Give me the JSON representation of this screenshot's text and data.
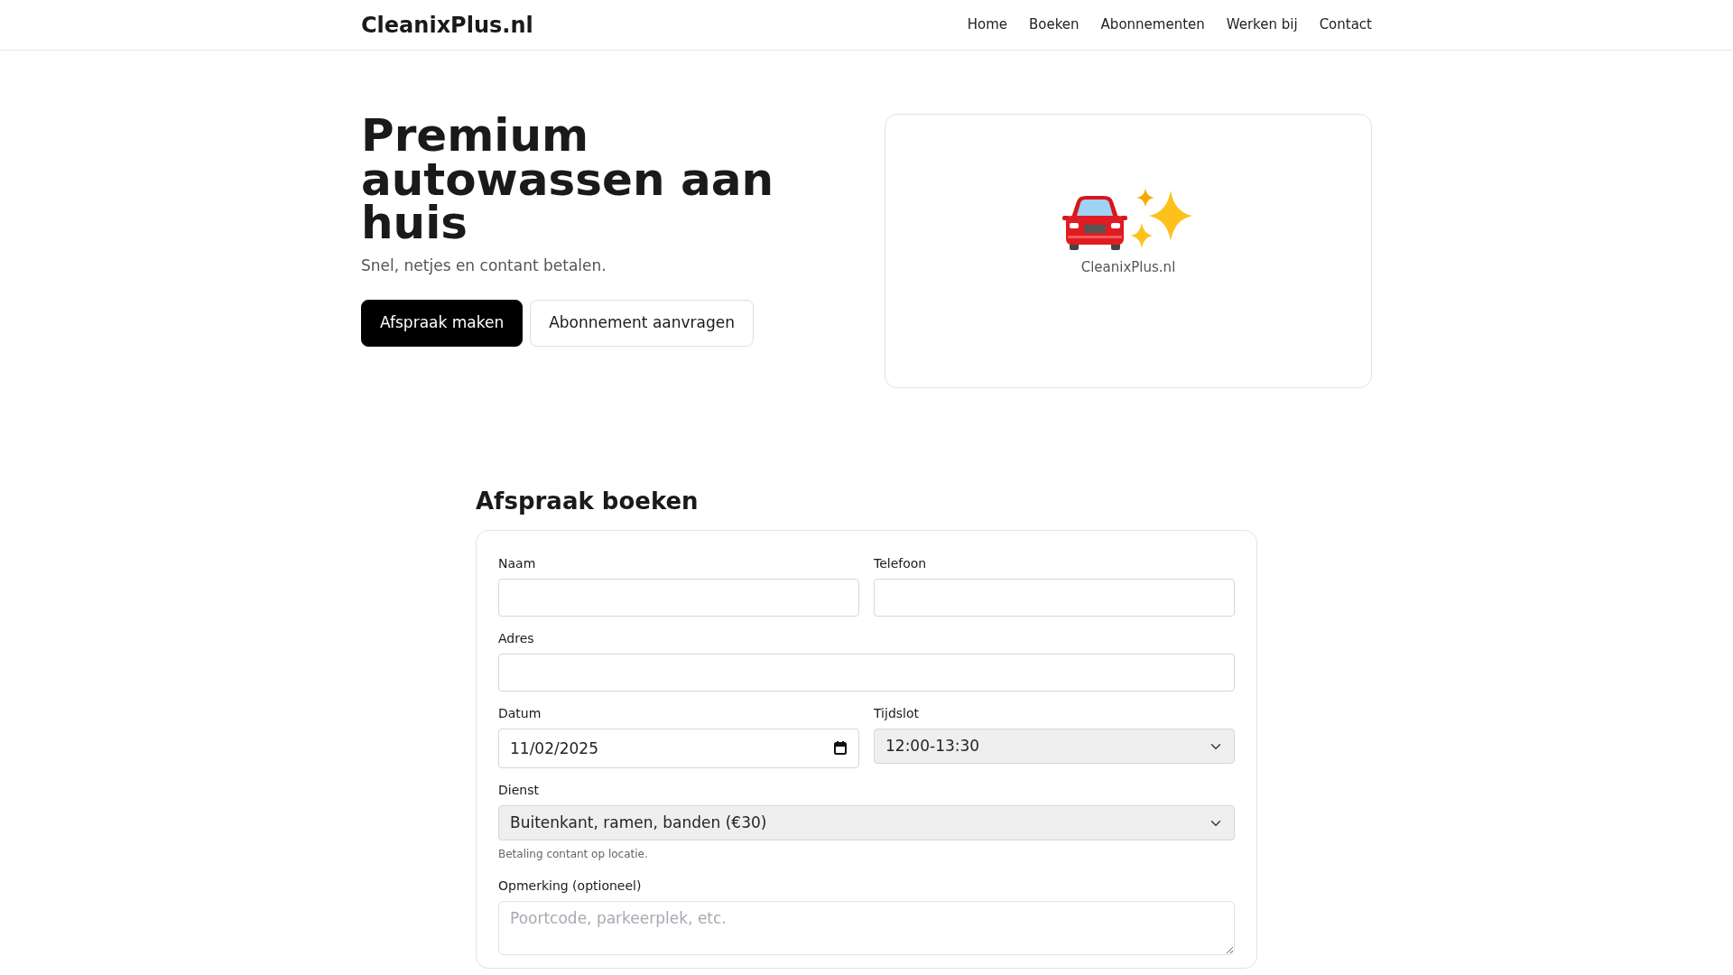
{
  "navbar": {
    "brand": "CleanixPlus.nl",
    "links": [
      "Home",
      "Boeken",
      "Abonnementen",
      "Werken bij",
      "Contact"
    ]
  },
  "hero": {
    "title": "Premium autowassen aan huis",
    "subtitle": "Snel, netjes en contant betalen.",
    "buttons": [
      {
        "label": "Afspraak maken",
        "kind": "primary"
      },
      {
        "label": "Abonnement aanvragen",
        "kind": "outline"
      }
    ],
    "card": {
      "caption": "CleanixPlus.nl"
    }
  },
  "booking": {
    "title": "Afspraak boeken",
    "rows": [
      [
        {
          "kind": "text",
          "label": "Naam"
        },
        {
          "kind": "text",
          "label": "Telefoon"
        }
      ],
      [
        {
          "kind": "text",
          "label": "Adres"
        }
      ],
      [
        {
          "kind": "date",
          "label": "Datum",
          "value": "11/02/2025"
        },
        {
          "kind": "select",
          "label": "Tijdslot",
          "value": "12:00-13:30"
        }
      ],
      [
        {
          "kind": "select",
          "label": "Dienst",
          "value": "Buitenkant, ramen, banden (€30)",
          "help": "Betaling contant op locatie."
        }
      ],
      [
        {
          "kind": "textarea",
          "label": "Opmerking (optioneel)",
          "placeholder": "Poortcode, parkeerplek, etc."
        }
      ]
    ]
  }
}
